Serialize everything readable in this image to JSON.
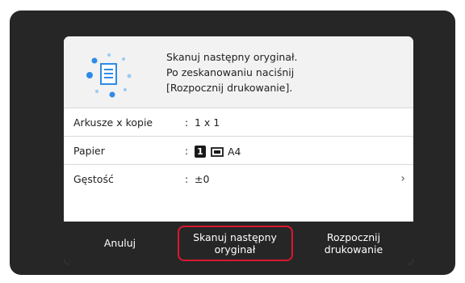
{
  "message": {
    "line1": "Skanuj następny oryginał.",
    "line2": "Po zeskanowaniu naciśnij",
    "line3": "[Rozpocznij drukowanie]."
  },
  "settings": [
    {
      "label": "Arkusze x kopie",
      "colon": ":",
      "value": "1 x 1"
    },
    {
      "label": "Papier",
      "colon": ":",
      "tray_number": "1",
      "paper_size": "A4"
    },
    {
      "label": "Gęstość",
      "colon": ":",
      "value": "±0",
      "chevron": "›"
    }
  ],
  "footer": {
    "cancel_label": "Anuluj",
    "next_label": "Skanuj następny\noryginał",
    "start_label": "Rozpocznij\ndrukowanie"
  },
  "colors": {
    "bezel": "#262626",
    "highlight": "#d9182d",
    "accent_blue": "#2e8be6",
    "light_blue": "#9ccaf2"
  },
  "icons": {
    "message_icon": "scan-document-icon",
    "tray_icon": "paper-tray-icon",
    "chevron": "chevron-right-icon"
  }
}
